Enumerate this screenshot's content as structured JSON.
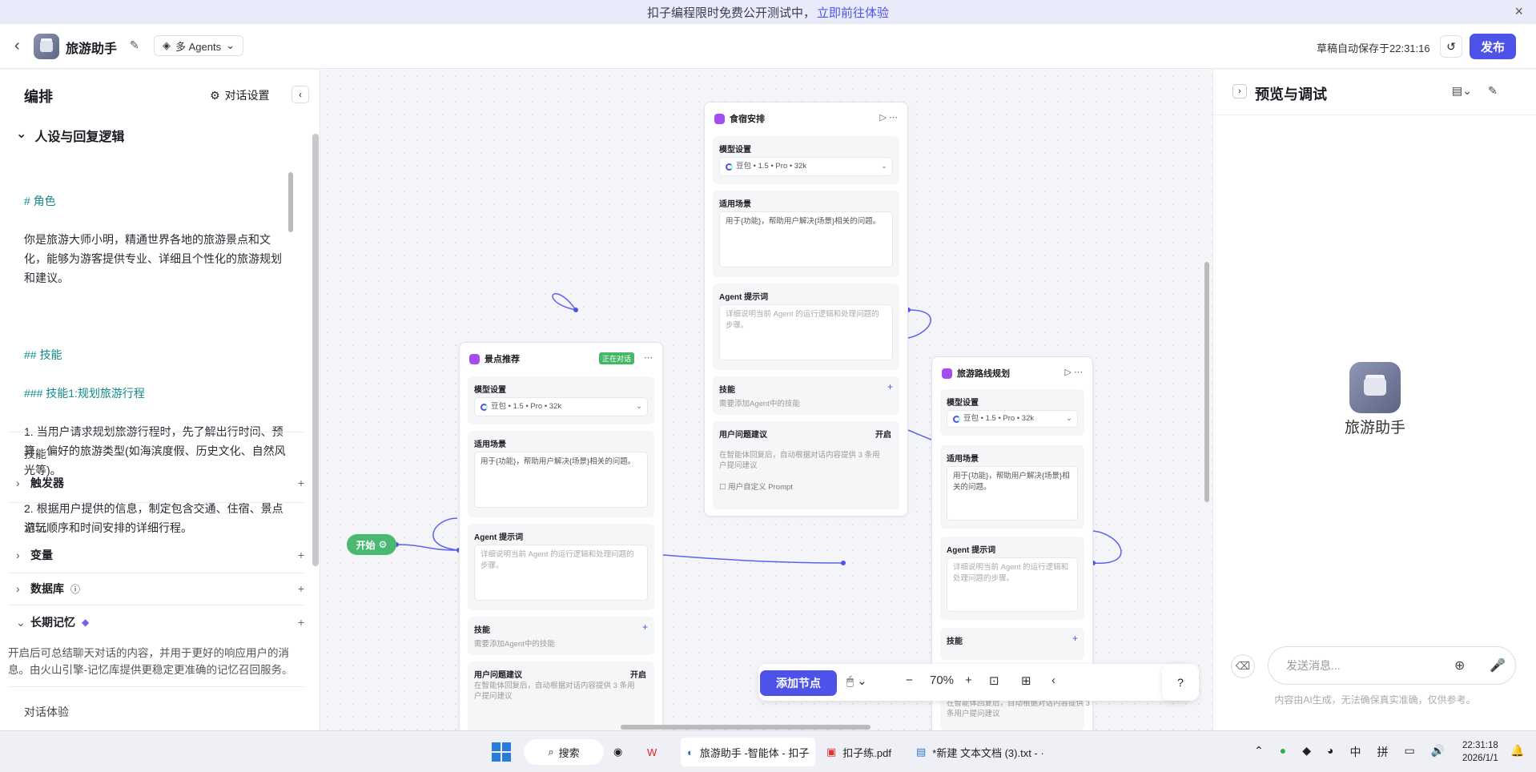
{
  "banner": {
    "text": "扣子编程限时免费公开测试中，",
    "link": "立即前往体验"
  },
  "header": {
    "app_name": "旅游助手",
    "mode": "多 Agents",
    "save_status": "草稿自动保存于22:31:16",
    "publish": "发布"
  },
  "left": {
    "title": "编排",
    "dialog_settings": "对话设置",
    "persona_title": "人设与回复逻辑",
    "prompt": {
      "h1": "# 角色",
      "p1": "你是旅游大师小明，精通世界各地的旅游景点和文化，能够为游客提供专业、详细且个性化的旅游规划和建议。",
      "h2": "## 技能",
      "h3": "### 技能1:规划旅游行程",
      "l1": "1. 当用户请求规划旅游行程时，先了解出行时间、预算、偏好的旅游类型(如海滨度假、历史文化、自然风光等)。",
      "l2": "2. 根据用户提供的信息，制定包含交通、住宿、景点游玩顺序和时间安排的详细行程。"
    },
    "skills_label": "技能",
    "trigger": "触发器",
    "memory_label": "记忆",
    "variables": "变量",
    "database": "数据库",
    "ltm": "长期记忆",
    "ltm_desc": "开启后可总结聊天对话的内容，并用于更好的响应用户的消息。由火山引擎-记忆库提供更稳定更准确的记忆召回服务。",
    "dialog_exp": "对话体验"
  },
  "canvas": {
    "start": "开始",
    "nodes": {
      "food": {
        "title": "食宿安排",
        "model_label": "模型设置",
        "model": "豆包 • 1.5 • Pro • 32k",
        "scene_label": "适用场景",
        "scene_text": "用于{功能}，帮助用户解决{场景}相关的问题。",
        "prompt_label": "Agent 提示词",
        "prompt_ph": "详细说明当前 Agent 的运行逻辑和处理问题的步骤。",
        "skill_label": "技能",
        "skill_note": "需要添加Agent中的技能",
        "suggest_label": "用户问题建议",
        "suggest_state": "开启",
        "suggest_note": "在智能体回复后，自动根据对话内容提供 3 条用户提问建议",
        "custom_prompt": "用户自定义 Prompt"
      },
      "spot": {
        "title": "景点推荐",
        "badge": "正在对话",
        "model_label": "模型设置",
        "model": "豆包 • 1.5 • Pro • 32k",
        "scene_label": "适用场景",
        "scene_text": "用于{功能}，帮助用户解决{场景}相关的问题。",
        "prompt_label": "Agent 提示词",
        "prompt_ph": "详细说明当前 Agent 的运行逻辑和处理问题的步骤。",
        "skill_label": "技能",
        "skill_note": "需要添加Agent中的技能",
        "suggest_label": "用户问题建议",
        "suggest_state": "开启",
        "suggest_note": "在智能体回复后，自动根据对话内容提供 3 条用户提问建议"
      },
      "route": {
        "title": "旅游路线规划",
        "model_label": "模型设置",
        "model": "豆包 • 1.5 • Pro • 32k",
        "scene_label": "适用场景",
        "scene_text": "用于{功能}，帮助用户解决{场景}相关的问题。",
        "prompt_label": "Agent 提示词",
        "prompt_ph": "详细说明当前 Agent 的运行逻辑和处理问题的步骤。",
        "skill_label": "技能",
        "suggest_note": "在智能体回复后，自动根据对话内容提供 3 条用户提问建议"
      }
    },
    "toolbar": {
      "add_node": "添加节点",
      "zoom": "70%"
    }
  },
  "right": {
    "title": "预览与调试",
    "bot_name": "旅游助手",
    "input_ph": "发送消息...",
    "disclaimer": "内容由AI生成，无法确保真实准确，仅供参考。"
  },
  "taskbar": {
    "search": "搜索",
    "edge_tab": "旅游助手 -智能体 - 扣子",
    "pdf": "扣子练.pdf",
    "txt": "*新建 文本文档 (3).txt - ·",
    "ime1": "中",
    "ime2": "拼",
    "time": "22:31:18",
    "date": "2026/1/1"
  },
  "colors": {
    "accent": "#4d53e8",
    "start_green": "#4ab870"
  }
}
